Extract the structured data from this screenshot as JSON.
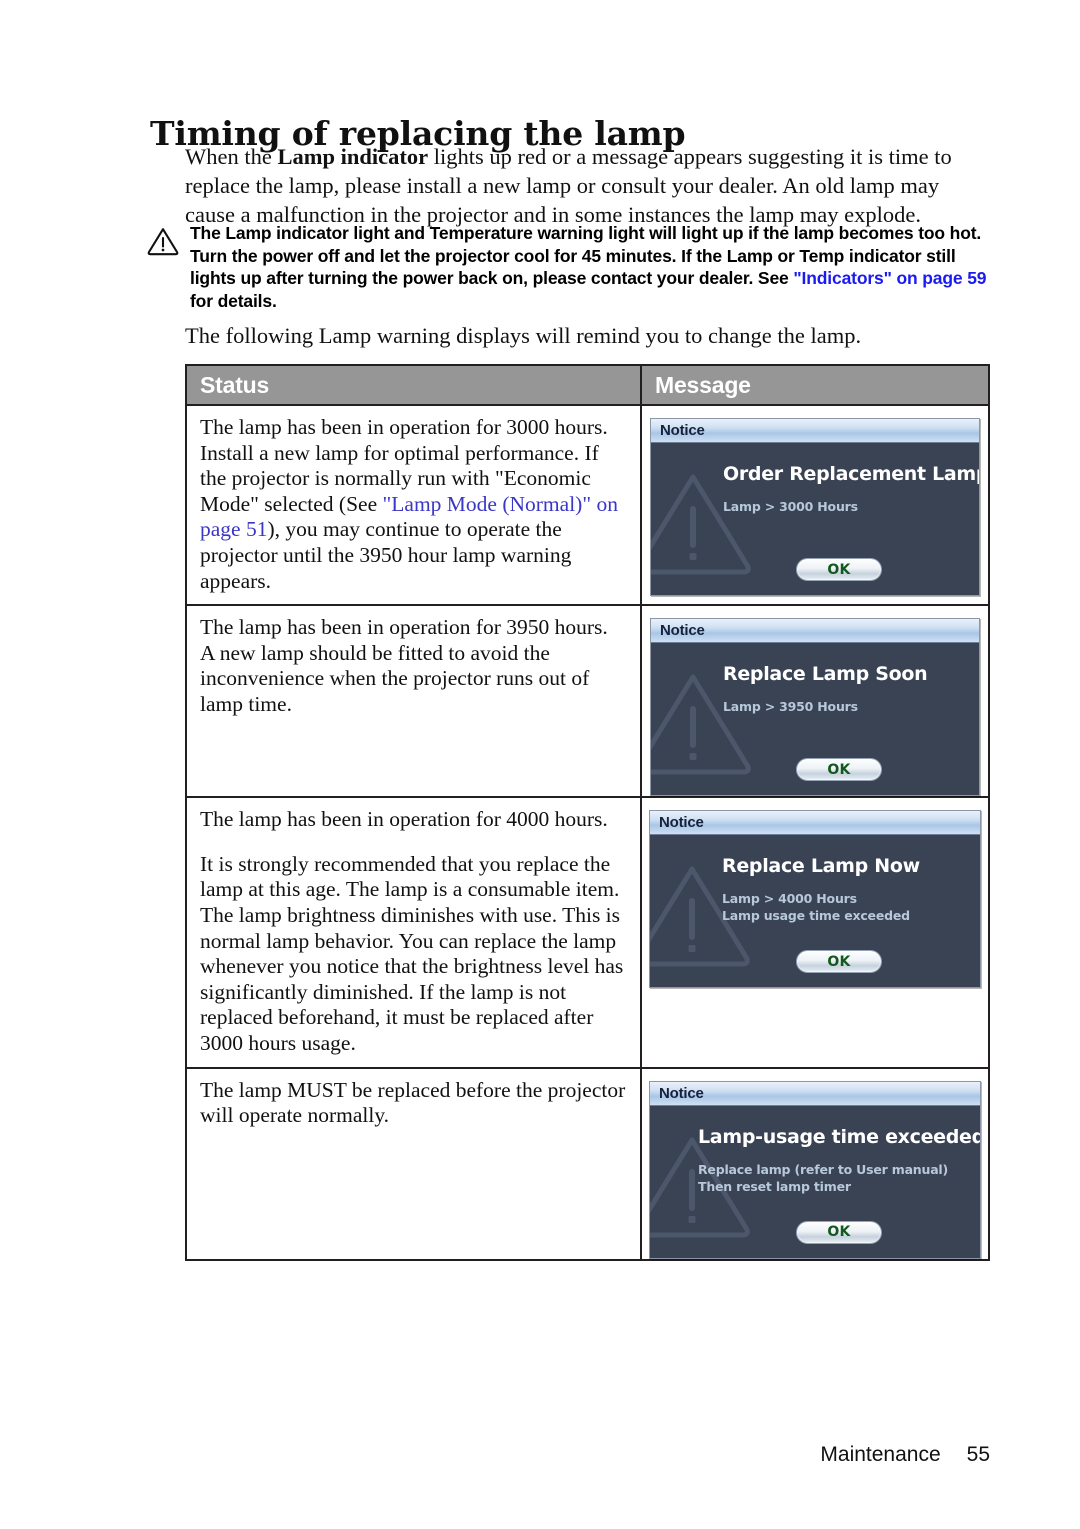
{
  "document": {
    "title": "Timing of replacing the lamp",
    "intro_parts": {
      "before": "When the ",
      "bold": "Lamp indicator",
      "after": " lights up red or a message appears suggesting it is time to replace the lamp, please install a new lamp or consult your dealer. An old lamp may cause a malfunction in the projector and in some instances the lamp may explode."
    },
    "note": {
      "icon": "warning-triangle-icon",
      "text_1": "The Lamp indicator light and Temperature warning light will light up if the lamp becomes too hot. Turn the power off and let the projector cool for 45 minutes. If the Lamp or Temp indicator still lights up after turning the power back on, please contact your dealer. See ",
      "link_1": "\"Indicators\" on page 59",
      "text_2": " for details."
    },
    "lead_in": "The following Lamp warning displays will remind you to change the lamp."
  },
  "table": {
    "headers": {
      "status": "Status",
      "message": "Message"
    },
    "rows": [
      {
        "status_paragraphs": [
          {
            "before": "The lamp has been in operation for 3000 hours. Install a new lamp for optimal performance. If the projector is normally run with \"Economic Mode\" selected (See ",
            "link": "\"Lamp Mode (Normal)\" on page 51",
            "after": "), you may continue to operate the projector until the 3950 hour lamp warning appears."
          }
        ],
        "dialog": {
          "titlebar": "Notice",
          "heading": "Order Replacement Lamp",
          "lines": [
            "Lamp > 3000 Hours"
          ],
          "ok_label": "OK",
          "watermark_icon": "warning-triangle-watermark-icon"
        }
      },
      {
        "status_paragraphs": [
          {
            "before": "The lamp has been in operation for 3950 hours. A new lamp should be fitted to avoid the inconvenience when the projector runs out of lamp time.",
            "link": "",
            "after": ""
          }
        ],
        "dialog": {
          "titlebar": "Notice",
          "heading": "Replace Lamp Soon",
          "lines": [
            "Lamp > 3950 Hours"
          ],
          "ok_label": "OK",
          "watermark_icon": "warning-triangle-watermark-icon"
        }
      },
      {
        "status_paragraphs": [
          {
            "before": "The lamp has been in operation for 4000 hours.",
            "link": "",
            "after": ""
          },
          {
            "before": "It is strongly recommended that you replace the lamp at this age. The lamp is a consumable item. The lamp brightness diminishes with use. This is normal lamp behavior. You can replace the lamp whenever you notice that the brightness level has significantly diminished. If the lamp is not replaced beforehand, it must be replaced after 3000 hours usage.",
            "link": "",
            "after": ""
          }
        ],
        "dialog": {
          "titlebar": "Notice",
          "heading": "Replace Lamp Now",
          "lines": [
            "Lamp > 4000 Hours",
            "Lamp usage time exceeded"
          ],
          "ok_label": "OK",
          "watermark_icon": "warning-triangle-watermark-icon"
        }
      },
      {
        "status_paragraphs": [
          {
            "before": "The lamp MUST be replaced before the projector will operate normally.",
            "link": "",
            "after": ""
          }
        ],
        "dialog": {
          "titlebar": "Notice",
          "heading": "Lamp-usage time exceeded",
          "lines": [
            "Replace lamp (refer to User manual)",
            "Then reset lamp timer"
          ],
          "ok_label": "OK",
          "watermark_icon": "warning-triangle-watermark-icon"
        }
      }
    ]
  },
  "footer": {
    "section": "Maintenance",
    "page_number": "55"
  },
  "colors": {
    "link_note": "#1b1bf0",
    "link_table": "#3a36c8",
    "table_header_bg": "#969696",
    "osd_body_bg": "#3a4354",
    "osd_title_text": "#16213c",
    "osd_line_text": "#b6c8da",
    "ok_text": "#13591f"
  }
}
